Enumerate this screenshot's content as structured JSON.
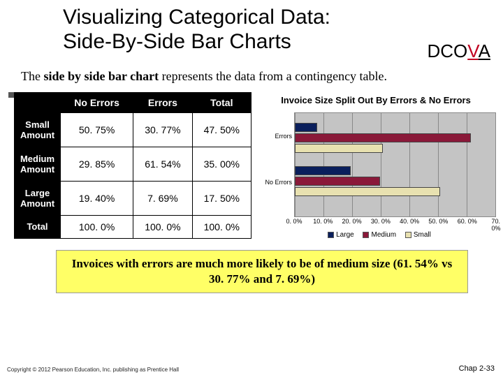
{
  "title_line1": "Visualizing Categorical Data:",
  "title_line2": "Side-By-Side Bar Charts",
  "dcova": {
    "pre": "DCO",
    "v": "V",
    "a": "A"
  },
  "intro_pre": "The ",
  "intro_bold": "side by side bar chart ",
  "intro_post": "represents the data from a contingency table.",
  "table": {
    "headers": [
      "",
      "No Errors",
      "Errors",
      "Total"
    ],
    "rows": [
      {
        "h": "Small Amount",
        "c": [
          "50. 75%",
          "30. 77%",
          "47. 50%"
        ]
      },
      {
        "h": "Medium Amount",
        "c": [
          "29. 85%",
          "61. 54%",
          "35. 00%"
        ]
      },
      {
        "h": "Large Amount",
        "c": [
          "19. 40%",
          "7. 69%",
          "17. 50%"
        ]
      },
      {
        "h": "Total",
        "c": [
          "100. 0%",
          "100. 0%",
          "100. 0%"
        ]
      }
    ]
  },
  "chart_data": {
    "type": "bar",
    "orientation": "horizontal",
    "title": "Invoice Size Split Out By Errors & No Errors",
    "categories": [
      "Errors",
      "No Errors"
    ],
    "series": [
      {
        "name": "Large",
        "color": "#0a1f5c",
        "values": [
          7.69,
          19.4
        ]
      },
      {
        "name": "Medium",
        "color": "#8a1939",
        "values": [
          61.54,
          29.85
        ]
      },
      {
        "name": "Small",
        "color": "#e8e1b0",
        "values": [
          30.77,
          50.75
        ]
      }
    ],
    "xlabel": "",
    "ylabel": "",
    "xlim": [
      0,
      70
    ],
    "ticks": [
      "0. 0%",
      "10. 0%",
      "20. 0%",
      "30. 0%",
      "40. 0%",
      "50. 0%",
      "60. 0%",
      "70. 0%"
    ]
  },
  "legend": {
    "large": "Large",
    "medium": "Medium",
    "small": "Small"
  },
  "callout": "Invoices with errors are much more likely to be of medium size (61. 54% vs 30. 77% and 7. 69%)",
  "footer_left": "Copyright © 2012 Pearson Education, Inc. publishing as Prentice Hall",
  "footer_right": "Chap 2-33"
}
